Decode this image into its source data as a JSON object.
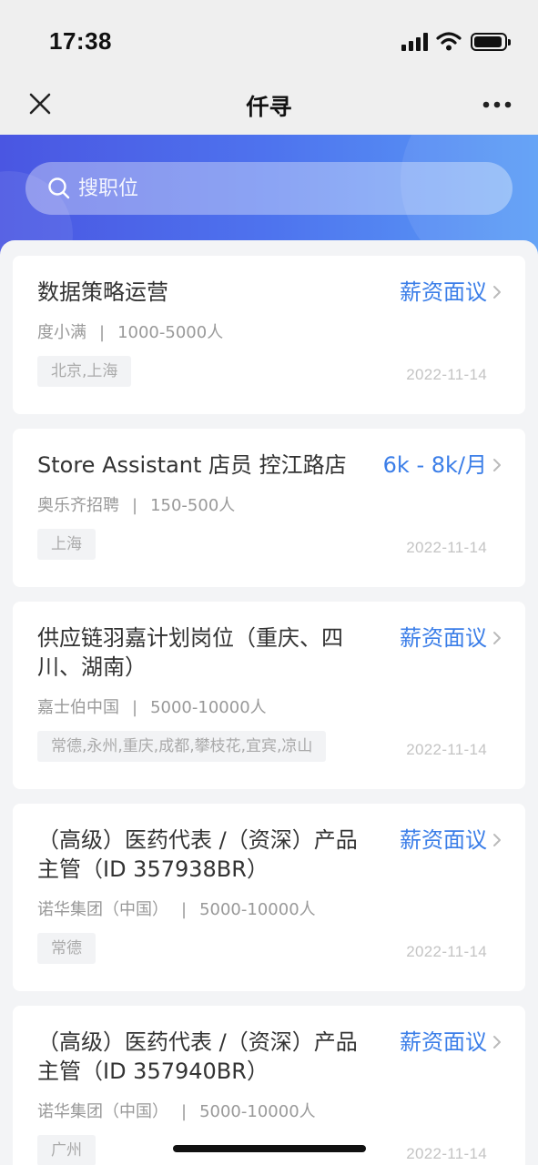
{
  "status_bar": {
    "time": "17:38"
  },
  "nav": {
    "title": "仟寻"
  },
  "search": {
    "placeholder": "搜职位"
  },
  "jobs": [
    {
      "title": "数据策略运营",
      "salary": "薪资面议",
      "company": "度小满",
      "size": "1000-5000人",
      "tag": "北京,上海",
      "date": "2022-11-14"
    },
    {
      "title": "Store Assistant 店员 控江路店",
      "salary": "6k - 8k/月",
      "company": "奥乐齐招聘",
      "size": "150-500人",
      "tag": "上海",
      "date": "2022-11-14"
    },
    {
      "title": "供应链羽嘉计划岗位（重庆、四川、湖南）",
      "salary": "薪资面议",
      "company": "嘉士伯中国",
      "size": "5000-10000人",
      "tag": "常德,永州,重庆,成都,攀枝花,宜宾,凉山",
      "date": "2022-11-14"
    },
    {
      "title": "（高级）医药代表 /（资深）产品主管（ID 357938BR）",
      "salary": "薪资面议",
      "company": "诺华集团（中国）",
      "size": "5000-10000人",
      "tag": "常德",
      "date": "2022-11-14"
    },
    {
      "title": "（高级）医药代表 /（资深）产品主管（ID 357940BR）",
      "salary": "薪资面议",
      "company": "诺华集团（中国）",
      "size": "5000-10000人",
      "tag": "广州",
      "date": "2022-11-14"
    }
  ],
  "meta_separator": "|",
  "colors": {
    "accent": "#3b7ee8",
    "hero_start": "#4a56e2",
    "hero_end": "#5a9df6"
  }
}
